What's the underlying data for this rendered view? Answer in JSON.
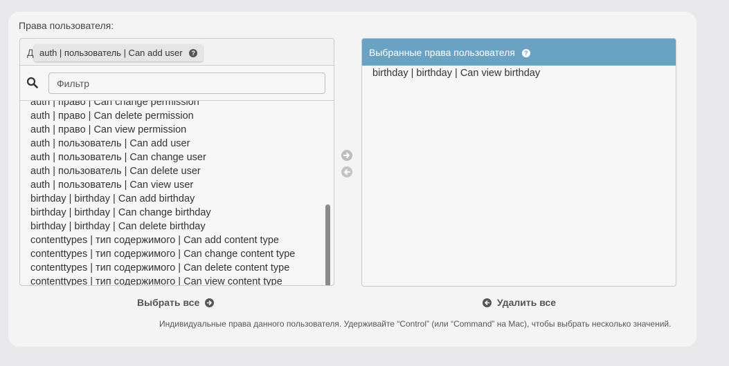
{
  "field": {
    "label": "Права пользователя:"
  },
  "available": {
    "title_prefix": "Д",
    "tooltip": "auth | пользователь | Can add user",
    "filter_placeholder": "Фильтр",
    "items": [
      "auth | право | Can change permission",
      "auth | право | Can delete permission",
      "auth | право | Can view permission",
      "auth | пользователь | Can add user",
      "auth | пользователь | Can change user",
      "auth | пользователь | Can delete user",
      "auth | пользователь | Can view user",
      "birthday | birthday | Can add birthday",
      "birthday | birthday | Can change birthday",
      "birthday | birthday | Can delete birthday",
      "contenttypes | тип содержимого | Can add content type",
      "contenttypes | тип содержимого | Can change content type",
      "contenttypes | тип содержимого | Can delete content type",
      "contenttypes | тип содержимого | Can view content type"
    ]
  },
  "chosen": {
    "title": "Выбранные права пользователя",
    "items": [
      "birthday | birthday | Can view birthday"
    ]
  },
  "actions": {
    "choose_all": "Выбрать все",
    "remove_all": "Удалить все"
  },
  "help": {
    "text": "Индивидуальные права данного пользователя. Удерживайте “Control” (или “Command” на Mac), чтобы выбрать несколько значений."
  },
  "icons": {
    "search": "search-icon",
    "help": "help-icon",
    "add_arrow": "arrow-right-icon",
    "remove_arrow": "arrow-left-icon"
  },
  "colors": {
    "chosen_header": "#6aa2c3",
    "panel_bg": "#f4f4f4",
    "page_bg": "#e8e8ea"
  }
}
